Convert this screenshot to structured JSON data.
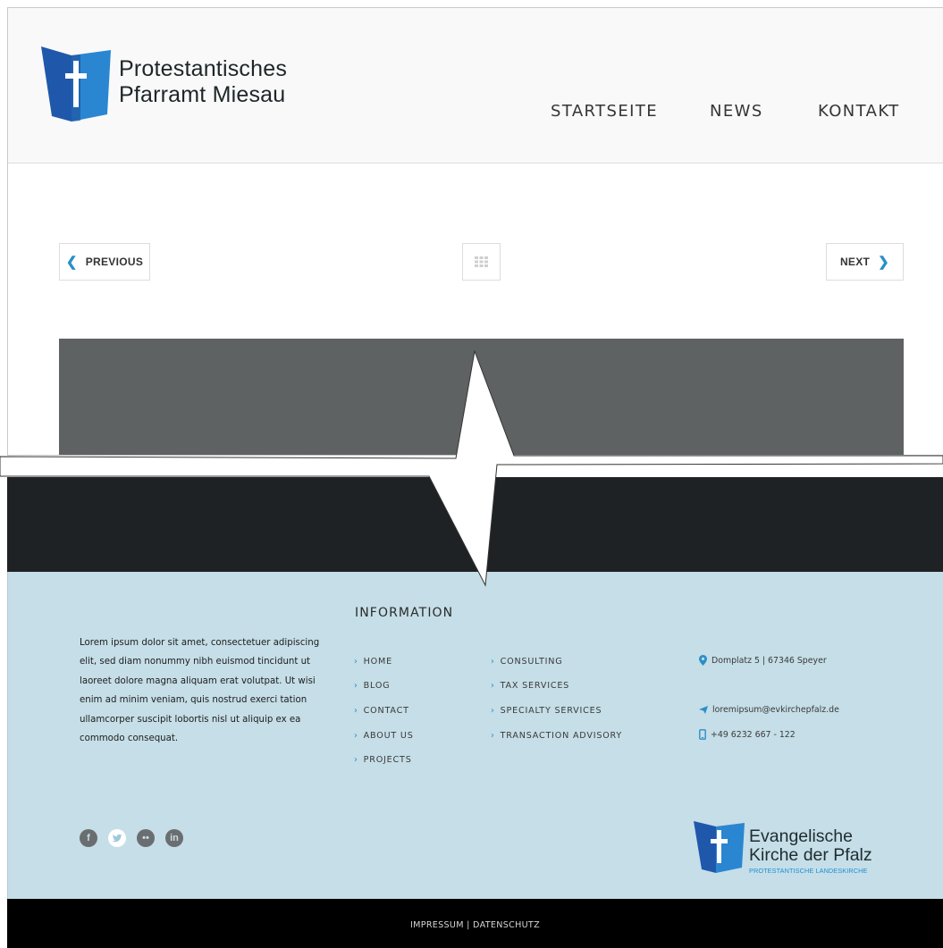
{
  "brand": {
    "line1": "Protestantisches",
    "line2": "Pfarramt Miesau",
    "color_blue": "#1f63b3",
    "color_blue_light": "#2a86d1"
  },
  "nav": {
    "items": [
      {
        "label": "STARTSEITE"
      },
      {
        "label": "NEWS"
      },
      {
        "label": "KONTAKT"
      }
    ]
  },
  "pager": {
    "previous_label": "PREVIOUS",
    "next_label": "NEXT",
    "grid_icon": "grid-icon",
    "accent": "#2a8fc9"
  },
  "footer": {
    "info_title": "INFORMATION",
    "text": "Lorem ipsum dolor sit amet, consectetuer adipiscing elit, sed diam nonummy nibh euismod tincidunt ut laoreet dolore magna aliquam erat volutpat. Ut wisi enim ad minim veniam, quis nostrud exerci tation ullamcorper suscipit lobortis nisl ut aliquip ex ea commodo consequat.",
    "links_col1": [
      "HOME",
      "BLOG",
      "CONTACT",
      "ABOUT US",
      "PROJECTS"
    ],
    "links_col2": [
      "CONSULTING",
      "TAX SERVICES",
      "SPECIALTY SERVICES",
      "TRANSACTION ADVISORY"
    ],
    "contact": {
      "address": "Domplatz 5 | 67346 Speyer",
      "email": "loremipsum@evkirchepfalz.de",
      "phone": "+49 6232 667 - 122"
    },
    "social": [
      {
        "icon": "facebook-icon",
        "glyph": "f"
      },
      {
        "icon": "twitter-icon",
        "glyph": "t"
      },
      {
        "icon": "flickr-icon",
        "glyph": "••"
      },
      {
        "icon": "linkedin-icon",
        "glyph": "in"
      }
    ],
    "partner": {
      "line1": "Evangelische",
      "line2": "Kirche der Pfalz",
      "subline": "PROTESTANTISCHE LANDESKIRCHE"
    },
    "legal": "IMPRESSUM | DATENSCHUTZ",
    "bg_color": "#c5dee7",
    "dark_band_color": "#1f2224"
  }
}
